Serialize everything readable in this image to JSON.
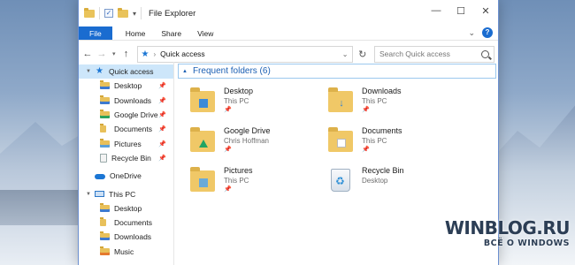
{
  "window": {
    "title": "File Explorer"
  },
  "ribbon": {
    "tabs": [
      "File",
      "Home",
      "Share",
      "View"
    ]
  },
  "address": {
    "location": "Quick access",
    "search_placeholder": "Search Quick access"
  },
  "navpane": {
    "items": [
      {
        "label": "Quick access",
        "level": 0,
        "icon": "star-icon",
        "selected": true
      },
      {
        "label": "Desktop",
        "level": 1,
        "icon": "folder-icon",
        "pinned": true
      },
      {
        "label": "Downloads",
        "level": 1,
        "icon": "downloads-folder-icon",
        "pinned": true
      },
      {
        "label": "Google Drive",
        "level": 1,
        "icon": "google-drive-folder-icon",
        "pinned": true
      },
      {
        "label": "Documents",
        "level": 1,
        "icon": "documents-folder-icon",
        "pinned": true
      },
      {
        "label": "Pictures",
        "level": 1,
        "icon": "pictures-folder-icon",
        "pinned": true
      },
      {
        "label": "Recycle Bin",
        "level": 1,
        "icon": "recycle-bin-icon",
        "pinned": true
      },
      {
        "label": "OneDrive",
        "level": 0,
        "icon": "onedrive-cloud-icon"
      },
      {
        "label": "This PC",
        "level": 0,
        "icon": "computer-icon"
      },
      {
        "label": "Desktop",
        "level": 1,
        "icon": "folder-icon"
      },
      {
        "label": "Documents",
        "level": 1,
        "icon": "documents-folder-icon"
      },
      {
        "label": "Downloads",
        "level": 1,
        "icon": "downloads-folder-icon"
      },
      {
        "label": "Music",
        "level": 1,
        "icon": "music-folder-icon"
      }
    ]
  },
  "main": {
    "group_title": "Frequent folders (6)",
    "folders": [
      {
        "name": "Desktop",
        "location": "This PC",
        "icon": "desktop-folder-icon"
      },
      {
        "name": "Downloads",
        "location": "This PC",
        "icon": "downloads-folder-icon"
      },
      {
        "name": "Google Drive",
        "location": "Chris Hoffman",
        "icon": "google-drive-folder-icon"
      },
      {
        "name": "Documents",
        "location": "This PC",
        "icon": "documents-folder-icon"
      },
      {
        "name": "Pictures",
        "location": "This PC",
        "icon": "pictures-folder-icon"
      },
      {
        "name": "Recycle Bin",
        "location": "Desktop",
        "icon": "recycle-bin-icon"
      }
    ]
  },
  "watermark": {
    "main": "WINBLOG.RU",
    "sub": "ВСЁ О WINDOWS"
  },
  "colors": {
    "accent": "#1a6cd0",
    "selection": "#cde6fa",
    "group_title": "#1b5fb3"
  }
}
